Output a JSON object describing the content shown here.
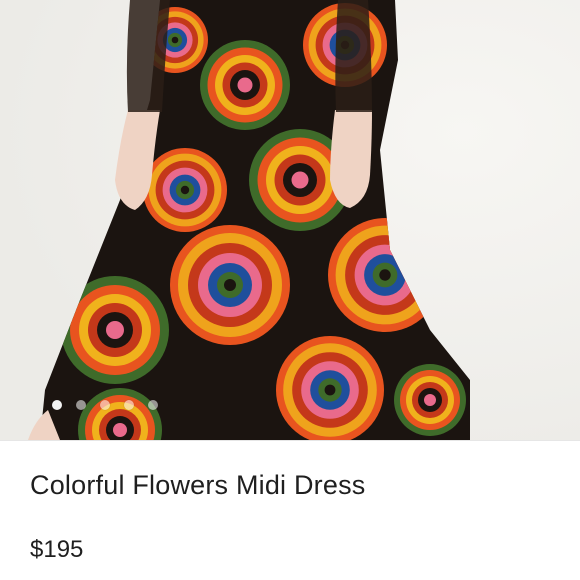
{
  "listing": {
    "title": "Colorful Flowers Midi Dress",
    "price": "$195"
  },
  "carousel": {
    "image_count": 5,
    "active_index": 0
  },
  "colors": {
    "text": "#1f1f1f",
    "background": "#ffffff",
    "dress_base": "#1b1410",
    "print_orange": "#e8541f",
    "print_yellow": "#f0b21c",
    "print_pink": "#e96a8c",
    "print_blue": "#1f4f9c",
    "print_green": "#3f6b2a"
  }
}
